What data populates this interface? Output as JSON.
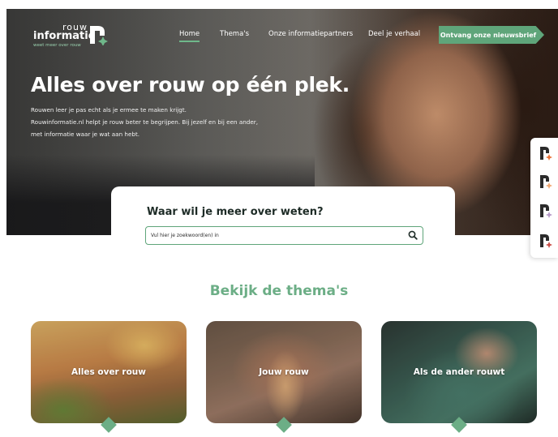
{
  "logo": {
    "word_top": "rouw",
    "word_main": "informatie",
    "tagline": "weet meer over rouw"
  },
  "nav": {
    "items": [
      {
        "label": "Home",
        "active": true
      },
      {
        "label": "Thema's",
        "active": false
      },
      {
        "label": "Onze informatiepartners",
        "active": false
      },
      {
        "label": "Deel je verhaal",
        "active": false
      }
    ],
    "cta_label": "Ontvang onze nieuwsbrief"
  },
  "hero": {
    "title": "Alles over rouw op één plek.",
    "lines": [
      "Rouwen leer je pas echt als je ermee te maken krijgt.",
      "Rouwinformatie.nl helpt je rouw beter te begrijpen. Bij jezelf en bij een ander,",
      "met informatie waar je wat aan hebt."
    ]
  },
  "search": {
    "title": "Waar wil je meer over weten?",
    "placeholder": "Vul hier je zoekwoord(en) in",
    "value": ""
  },
  "themes": {
    "title": "Bekijk de thema's",
    "cards": [
      {
        "label": "Alles over rouw"
      },
      {
        "label": "Jouw rouw"
      },
      {
        "label": "Als de ander rouwt"
      }
    ]
  },
  "side_toolbar": {
    "icons": [
      "logo-mark-orange-icon",
      "logo-mark-peach-icon",
      "logo-mark-lilac-icon",
      "logo-mark-red-icon"
    ]
  },
  "colors": {
    "brand_green": "#5fa57a",
    "heading_green": "#6cae86",
    "text_dark": "#1d2b26"
  }
}
